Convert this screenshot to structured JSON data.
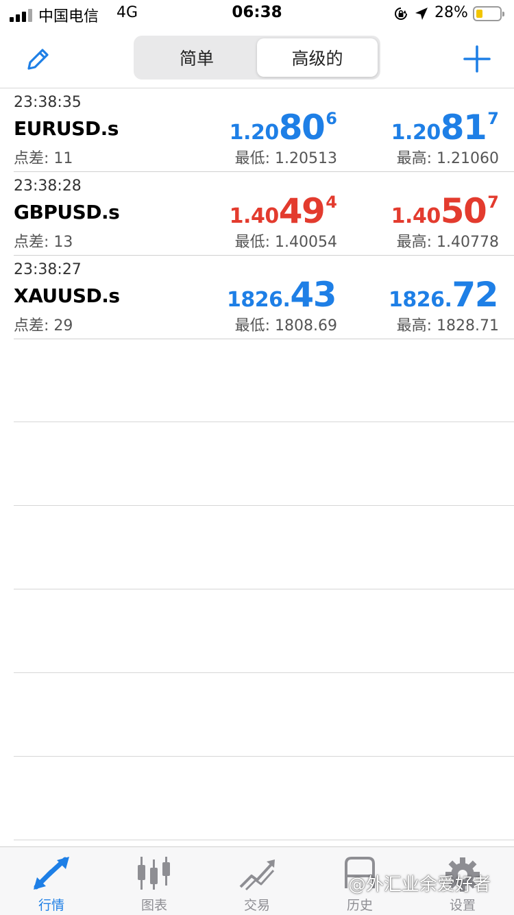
{
  "status_bar": {
    "carrier": "中国电信",
    "network": "4G",
    "time": "06:38",
    "battery_percent": "28%",
    "battery_level": 0.28
  },
  "nav": {
    "segments": [
      "简单",
      "高级的"
    ],
    "selected_segment": "高级的",
    "icons": {
      "edit": "pencil-icon",
      "add": "plus-icon"
    },
    "accent_color": "#1e7fe6"
  },
  "quotes": [
    {
      "time": "23:38:35",
      "symbol": "EURUSD.s",
      "spread": "点差: 11",
      "bid": {
        "pre": "1.20",
        "big": "80",
        "sup": "6",
        "color": "blue"
      },
      "ask": {
        "pre": "1.20",
        "big": "81",
        "sup": "7",
        "color": "blue"
      },
      "low": "最低: 1.20513",
      "high": "最高: 1.21060"
    },
    {
      "time": "23:38:28",
      "symbol": "GBPUSD.s",
      "spread": "点差: 13",
      "bid": {
        "pre": "1.40",
        "big": "49",
        "sup": "4",
        "color": "red"
      },
      "ask": {
        "pre": "1.40",
        "big": "50",
        "sup": "7",
        "color": "red"
      },
      "low": "最低: 1.40054",
      "high": "最高: 1.40778"
    },
    {
      "time": "23:38:27",
      "symbol": "XAUUSD.s",
      "spread": "点差: 29",
      "bid": {
        "pre": "1826.",
        "big": "43",
        "sup": "",
        "color": "blue"
      },
      "ask": {
        "pre": "1826.",
        "big": "72",
        "sup": "",
        "color": "blue"
      },
      "low": "最低: 1808.69",
      "high": "最高: 1828.71"
    }
  ],
  "price_colors": {
    "up": "#1e7fe6",
    "down": "#e33b2e"
  },
  "tabs": [
    {
      "label": "行情",
      "icon": "quotes-arrows-icon",
      "active": true
    },
    {
      "label": "图表",
      "icon": "candlestick-chart-icon",
      "active": false
    },
    {
      "label": "交易",
      "icon": "trade-trend-icon",
      "active": false
    },
    {
      "label": "历史",
      "icon": "history-icon",
      "active": false
    },
    {
      "label": "设置",
      "icon": "gear-icon",
      "active": false
    }
  ],
  "watermark": "@外汇业余爱好者"
}
